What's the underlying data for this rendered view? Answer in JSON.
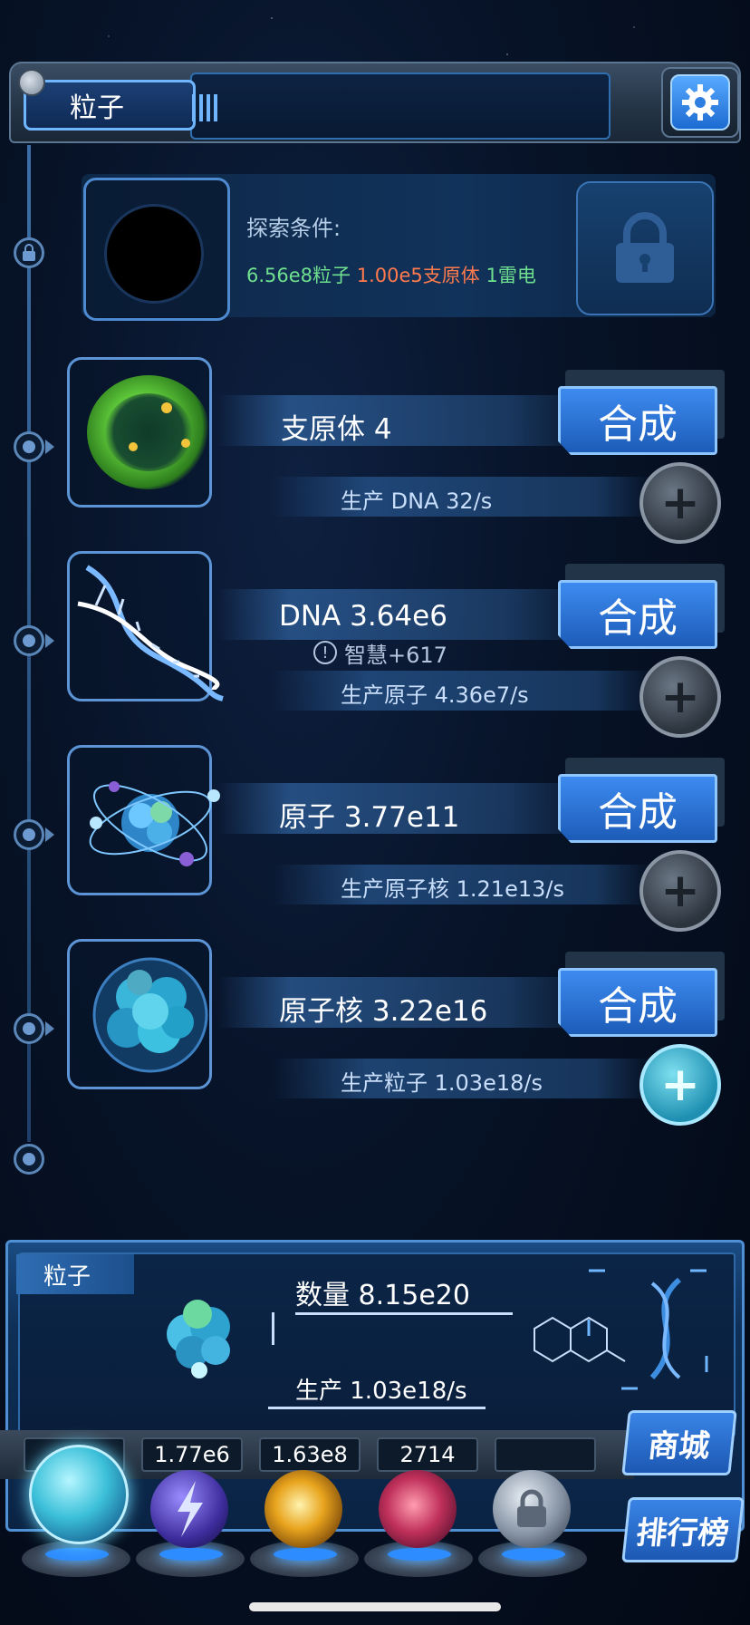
{
  "header": {
    "title": "粒子",
    "settings_icon": "gear-icon"
  },
  "locked_item": {
    "explore_label": "探索条件:",
    "requirements": [
      {
        "text": "6.56e8粒子",
        "color": "#6fe08f"
      },
      {
        "text": "1.00e5支原体",
        "color": "#ff7a4d"
      },
      {
        "text": "1雷电",
        "color": "#6fe08f"
      }
    ],
    "lock_icon": "lock-icon"
  },
  "items": [
    {
      "name": "支原体 4",
      "production": "生产 DNA 32/s",
      "button": "合成",
      "icon": "mycoplasma-icon",
      "plus_active": false
    },
    {
      "name": "DNA 3.64e6",
      "production": "生产原子 4.36e7/s",
      "button": "合成",
      "icon": "dna-icon",
      "plus_active": false
    },
    {
      "name": "原子 3.77e11",
      "production": "生产原子核 1.21e13/s",
      "button": "合成",
      "icon": "atom-icon",
      "plus_active": false
    },
    {
      "name": "原子核 3.22e16",
      "production": "生产粒子 1.03e18/s",
      "button": "合成",
      "icon": "nucleus-icon",
      "plus_active": true
    }
  ],
  "tooltip": {
    "text": "智慧+617"
  },
  "bottom": {
    "tag": "粒子",
    "count": "数量 8.15e20",
    "production": "生产 1.03e18/s"
  },
  "resources": [
    "",
    "1.77e6",
    "1.63e8",
    "2714",
    ""
  ],
  "side_buttons": {
    "shop": "商城",
    "rank": "排行榜"
  },
  "colors": {
    "accent": "#3d8bf0",
    "green": "#6fe08f",
    "orange": "#ff7a4d"
  }
}
